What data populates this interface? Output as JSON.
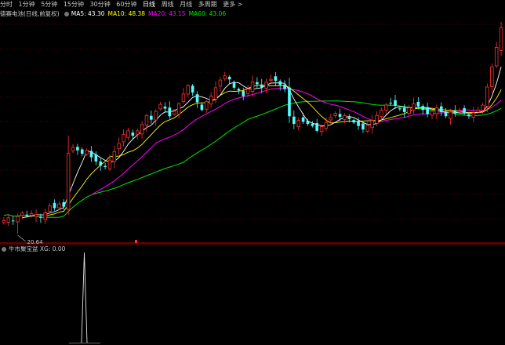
{
  "toolbar": {
    "items": [
      "分时",
      "1分钟",
      "5分钟",
      "15分钟",
      "30分钟",
      "60分钟",
      "日线",
      "周线",
      "月线",
      "多周期",
      "更多 >"
    ],
    "active_index": 6
  },
  "legend": {
    "title": "德赛电池(日线,前复权)",
    "ma5": "MA5: 43.30",
    "ma10": "MA10: 48.38",
    "ma20": "MA20: 43.15",
    "ma60": "MA60: 43.06"
  },
  "indicator": {
    "label": "牛市聚宝盆 XG: 0.00"
  },
  "colors": {
    "up": "#ff3232",
    "down": "#54fcfc",
    "ma5": "#ffffff",
    "ma10": "#ffff00",
    "ma20": "#ff00ff",
    "ma60": "#00e600",
    "grid": "#8b0000",
    "text": "#c8c8c8"
  },
  "chart_data": {
    "type": "candlestick",
    "low_label": "20.64",
    "closes": [
      22.5,
      22.9,
      22.4,
      23.1,
      23.6,
      23.2,
      23.5,
      23.4,
      22.9,
      23.7,
      24.6,
      24.3,
      24.9,
      24.5,
      32.2,
      33.0,
      32.6,
      32.1,
      32.6,
      31.6,
      31.0,
      30.4,
      30.2,
      31.2,
      32.4,
      33.6,
      34.9,
      35.4,
      34.7,
      35.4,
      36.3,
      37.6,
      37.0,
      38.2,
      39.2,
      38.6,
      37.5,
      38.2,
      39.3,
      40.7,
      41.9,
      40.9,
      39.5,
      38.4,
      39.6,
      40.4,
      41.6,
      42.7,
      43.3,
      42.8,
      41.6,
      41.2,
      40.4,
      41.4,
      42.4,
      42.1,
      41.6,
      42.4,
      42.8,
      42.6,
      42.0,
      41.4,
      37.5,
      36.4,
      36.9,
      36.7,
      36.4,
      36.1,
      35.4,
      36.0,
      36.6,
      37.3,
      37.9,
      37.4,
      37.6,
      37.1,
      36.6,
      36.1,
      35.6,
      36.2,
      36.9,
      37.6,
      38.4,
      39.1,
      39.4,
      39.0,
      38.5,
      38.1,
      38.7,
      39.3,
      38.9,
      38.4,
      37.8,
      38.2,
      38.7,
      38.1,
      37.5,
      38.1,
      37.9,
      38.3,
      38.0,
      37.5,
      38.0,
      38.4,
      39.1,
      41.7,
      44.6,
      47.4,
      50.2
    ]
  }
}
